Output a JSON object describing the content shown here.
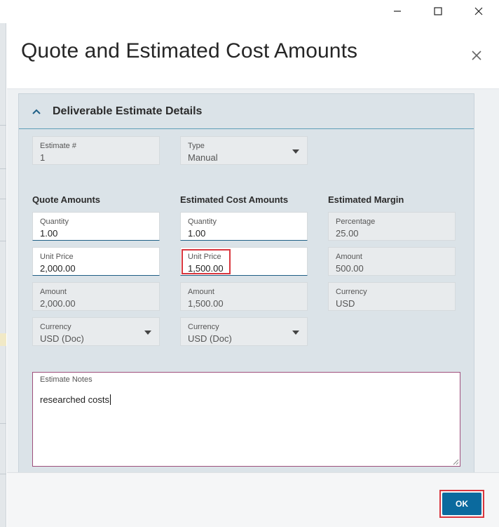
{
  "window": {
    "controls": [
      "minimize",
      "maximize",
      "close"
    ]
  },
  "dialog": {
    "title": "Quote and Estimated Cost Amounts",
    "close_icon": "close-icon"
  },
  "section": {
    "title": "Deliverable Estimate Details",
    "collapse_icon": "chevron-up-icon"
  },
  "estimate": {
    "number_label": "Estimate #",
    "number_value": "1",
    "type_label": "Type",
    "type_value": "Manual"
  },
  "quote": {
    "heading": "Quote Amounts",
    "quantity_label": "Quantity",
    "quantity_value": "1.00",
    "unit_price_label": "Unit Price",
    "unit_price_value": "2,000.00",
    "amount_label": "Amount",
    "amount_value": "2,000.00",
    "currency_label": "Currency",
    "currency_value": "USD (Doc)"
  },
  "cost": {
    "heading": "Estimated Cost Amounts",
    "quantity_label": "Quantity",
    "quantity_value": "1.00",
    "unit_price_label": "Unit Price",
    "unit_price_value": "1,500.00",
    "amount_label": "Amount",
    "amount_value": "1,500.00",
    "currency_label": "Currency",
    "currency_value": "USD (Doc)"
  },
  "margin": {
    "heading": "Estimated Margin",
    "percentage_label": "Percentage",
    "percentage_value": "25.00",
    "amount_label": "Amount",
    "amount_value": "500.00",
    "currency_label": "Currency",
    "currency_value": "USD"
  },
  "notes": {
    "label": "Estimate Notes",
    "value": "researched costs"
  },
  "footer": {
    "ok_label": "OK"
  },
  "colors": {
    "primary_button": "#0b6a9e",
    "highlight": "#d9363e",
    "section_bg": "#dbe3e8",
    "notes_border": "#9e4f7c"
  }
}
